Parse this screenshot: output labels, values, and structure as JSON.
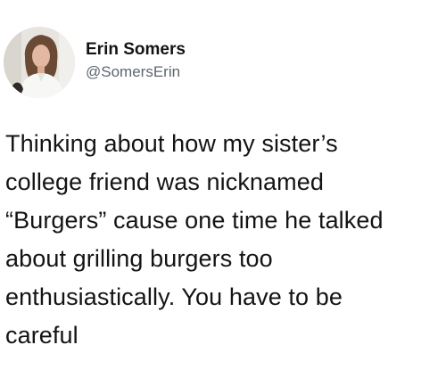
{
  "tweet": {
    "author": {
      "display_name": "Erin Somers",
      "handle": "@SomersErin",
      "avatar_icon": "profile-photo-avatar"
    },
    "text_lines": [
      "Thinking about how my sister’s",
      "college friend was nicknamed",
      "“Burgers” cause one time he talked",
      "about grilling burgers too",
      "enthusiastically. You have to be",
      "careful"
    ]
  },
  "colors": {
    "background": "#ffffff",
    "text": "#141414",
    "handle": "#5b6670"
  }
}
